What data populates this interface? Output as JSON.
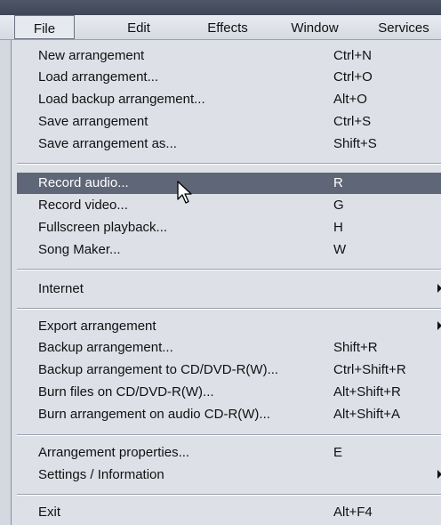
{
  "menubar": {
    "items": [
      {
        "label": "File",
        "active": true
      },
      {
        "label": "Edit"
      },
      {
        "label": "Effects"
      },
      {
        "label": "Window"
      },
      {
        "label": "Services"
      }
    ]
  },
  "file_menu": {
    "items": [
      {
        "label": "New arrangement",
        "shortcut": "Ctrl+N"
      },
      {
        "label": "Load arrangement...",
        "shortcut": "Ctrl+O"
      },
      {
        "label": "Load backup arrangement...",
        "shortcut": "Alt+O"
      },
      {
        "label": "Save arrangement",
        "shortcut": "Ctrl+S"
      },
      {
        "label": "Save arrangement as...",
        "shortcut": "Shift+S"
      },
      {
        "label": "Record audio...",
        "shortcut": "R"
      },
      {
        "label": "Record video...",
        "shortcut": "G"
      },
      {
        "label": "Fullscreen playback...",
        "shortcut": "H"
      },
      {
        "label": "Song Maker...",
        "shortcut": "W"
      },
      {
        "label": "Internet",
        "shortcut": ""
      },
      {
        "label": "Export arrangement",
        "shortcut": ""
      },
      {
        "label": "Backup arrangement...",
        "shortcut": "Shift+R"
      },
      {
        "label": "Backup arrangement to CD/DVD-R(W)...",
        "shortcut": "Ctrl+Shift+R"
      },
      {
        "label": "Burn files on CD/DVD-R(W)...",
        "shortcut": "Alt+Shift+R"
      },
      {
        "label": "Burn arrangement on audio CD-R(W)...",
        "shortcut": "Alt+Shift+A"
      },
      {
        "label": "Arrangement properties...",
        "shortcut": "E"
      },
      {
        "label": "Settings / Information",
        "shortcut": ""
      },
      {
        "label": "Exit",
        "shortcut": "Alt+F4"
      }
    ]
  },
  "colors": {
    "highlight": "#5f6677",
    "menu_background": "#dde0e7",
    "titlebar": "#474e60"
  },
  "icons": {
    "submenu_arrow": "triangle-right-icon",
    "cursor": "mouse-pointer-icon"
  }
}
